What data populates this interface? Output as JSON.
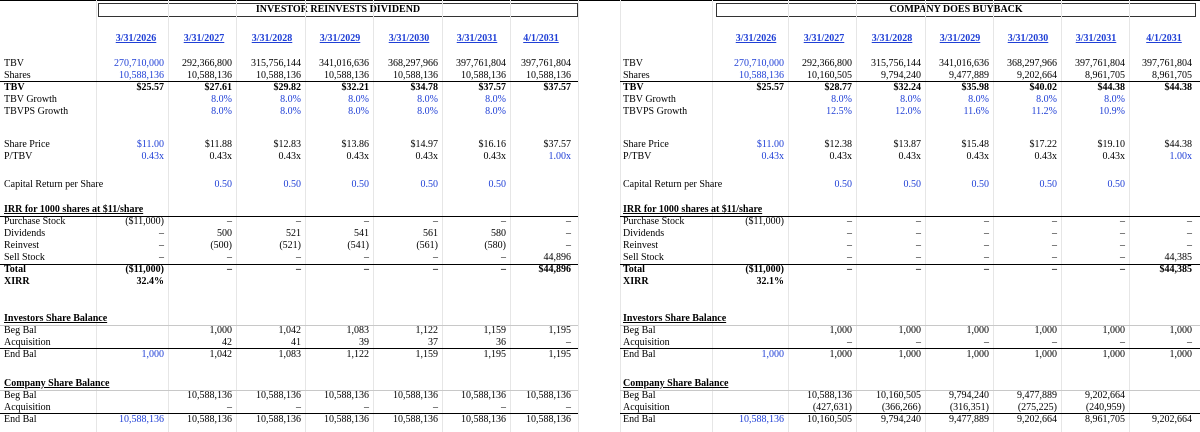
{
  "left_title": "INVESTOR REINVESTS DIVIDEND",
  "right_title": "COMPANY DOES BUYBACK",
  "left": {
    "dates": [
      "3/31/2026",
      "3/31/2027",
      "3/31/2028",
      "3/31/2029",
      "3/31/2030",
      "3/31/2031",
      "4/1/2031"
    ],
    "sections": [
      {
        "rows": [
          {
            "label": "TBV",
            "values": [
              "270,710,000",
              "292,366,800",
              "315,756,144",
              "341,016,636",
              "368,297,966",
              "397,761,804",
              "397,761,804"
            ]
          },
          {
            "label": "Shares",
            "values": [
              "10,588,136",
              "10,588,136",
              "10,588,136",
              "10,588,136",
              "10,588,136",
              "10,588,136",
              "10,588,136"
            ]
          },
          {
            "label": "TBV",
            "values": [
              "$25.57",
              "$27.61",
              "$29.82",
              "$32.21",
              "$34.78",
              "$37.57",
              "$37.57"
            ]
          },
          {
            "label": "TBV Growth",
            "values": [
              "",
              "8.0%",
              "8.0%",
              "8.0%",
              "8.0%",
              "8.0%",
              ""
            ]
          },
          {
            "label": "TBVPS Growth",
            "values": [
              "",
              "8.0%",
              "8.0%",
              "8.0%",
              "8.0%",
              "8.0%",
              ""
            ]
          }
        ]
      },
      {
        "rows": [
          {
            "label": "Share Price",
            "values": [
              "$11.00",
              "$11.88",
              "$12.83",
              "$13.86",
              "$14.97",
              "$16.16",
              "$37.57"
            ]
          },
          {
            "label": "P/TBV",
            "values": [
              "0.43x",
              "0.43x",
              "0.43x",
              "0.43x",
              "0.43x",
              "0.43x",
              "1.00x"
            ]
          }
        ]
      },
      {
        "rows": [
          {
            "label": "Capital Return per Share",
            "values": [
              "",
              "0.50",
              "0.50",
              "0.50",
              "0.50",
              "0.50",
              ""
            ]
          }
        ]
      },
      {
        "rows": [
          {
            "label": "IRR for 1000 shares at $11/share",
            "values": [
              "",
              "",
              "",
              "",
              "",
              "",
              ""
            ]
          },
          {
            "label": "Purchase Stock",
            "values": [
              "($11,000)",
              "–",
              "–",
              "–",
              "–",
              "–",
              "–"
            ]
          },
          {
            "label": "Dividends",
            "values": [
              "–",
              "500",
              "521",
              "541",
              "561",
              "580",
              "–"
            ]
          },
          {
            "label": "Reinvest",
            "values": [
              "–",
              "(500)",
              "(521)",
              "(541)",
              "(561)",
              "(580)",
              "–"
            ]
          },
          {
            "label": "Sell Stock",
            "values": [
              "–",
              "–",
              "–",
              "–",
              "–",
              "–",
              "44,896"
            ]
          },
          {
            "label": "Total",
            "values": [
              "($11,000)",
              "–",
              "–",
              "–",
              "–",
              "–",
              "$44,896"
            ]
          },
          {
            "label": "XIRR",
            "values": [
              "32.4%",
              "",
              "",
              "",
              "",
              "",
              ""
            ]
          }
        ]
      },
      {
        "rows": [
          {
            "label": "Investors Share Balance",
            "values": [
              "",
              "",
              "",
              "",
              "",
              "",
              ""
            ]
          },
          {
            "label": "Beg Bal",
            "values": [
              "",
              "1,000",
              "1,042",
              "1,083",
              "1,122",
              "1,159",
              "1,195"
            ]
          },
          {
            "label": "Acquisition",
            "values": [
              "",
              "42",
              "41",
              "39",
              "37",
              "36",
              "–"
            ]
          },
          {
            "label": "End Bal",
            "values": [
              "1,000",
              "1,042",
              "1,083",
              "1,122",
              "1,159",
              "1,195",
              "1,195"
            ]
          }
        ]
      },
      {
        "rows": [
          {
            "label": "Company Share Balance",
            "values": [
              "",
              "",
              "",
              "",
              "",
              "",
              ""
            ]
          },
          {
            "label": "Beg Bal",
            "values": [
              "",
              "10,588,136",
              "10,588,136",
              "10,588,136",
              "10,588,136",
              "10,588,136",
              "10,588,136"
            ]
          },
          {
            "label": "Acquisition",
            "values": [
              "",
              "–",
              "–",
              "–",
              "–",
              "–",
              "–"
            ]
          },
          {
            "label": "End Bal",
            "values": [
              "10,588,136",
              "10,588,136",
              "10,588,136",
              "10,588,136",
              "10,588,136",
              "10,588,136",
              "10,588,136"
            ]
          }
        ]
      }
    ]
  },
  "right": {
    "dates": [
      "3/31/2026",
      "3/31/2027",
      "3/31/2028",
      "3/31/2029",
      "3/31/2030",
      "3/31/2031",
      "4/1/2031"
    ],
    "sections": [
      {
        "rows": [
          {
            "label": "TBV",
            "values": [
              "270,710,000",
              "292,366,800",
              "315,756,144",
              "341,016,636",
              "368,297,966",
              "397,761,804",
              "397,761,804"
            ]
          },
          {
            "label": "Shares",
            "values": [
              "10,588,136",
              "10,160,505",
              "9,794,240",
              "9,477,889",
              "9,202,664",
              "8,961,705",
              "8,961,705"
            ]
          },
          {
            "label": "TBV",
            "values": [
              "$25.57",
              "$28.77",
              "$32.24",
              "$35.98",
              "$40.02",
              "$44.38",
              "$44.38"
            ]
          },
          {
            "label": "TBV Growth",
            "values": [
              "",
              "8.0%",
              "8.0%",
              "8.0%",
              "8.0%",
              "8.0%",
              ""
            ]
          },
          {
            "label": "TBVPS Growth",
            "values": [
              "",
              "12.5%",
              "12.0%",
              "11.6%",
              "11.2%",
              "10.9%",
              ""
            ]
          }
        ]
      },
      {
        "rows": [
          {
            "label": "Share Price",
            "values": [
              "$11.00",
              "$12.38",
              "$13.87",
              "$15.48",
              "$17.22",
              "$19.10",
              "$44.38"
            ]
          },
          {
            "label": "P/TBV",
            "values": [
              "0.43x",
              "0.43x",
              "0.43x",
              "0.43x",
              "0.43x",
              "0.43x",
              "1.00x"
            ]
          }
        ]
      },
      {
        "rows": [
          {
            "label": "Capital Return per Share",
            "values": [
              "",
              "0.50",
              "0.50",
              "0.50",
              "0.50",
              "0.50",
              ""
            ]
          }
        ]
      },
      {
        "rows": [
          {
            "label": "IRR for 1000 shares at $11/share",
            "values": [
              "",
              "",
              "",
              "",
              "",
              "",
              ""
            ]
          },
          {
            "label": "Purchase Stock",
            "values": [
              "($11,000)",
              "–",
              "–",
              "–",
              "–",
              "–",
              "–"
            ]
          },
          {
            "label": "Dividends",
            "values": [
              "",
              "–",
              "–",
              "–",
              "–",
              "–",
              "–"
            ]
          },
          {
            "label": "Reinvest",
            "values": [
              "",
              "–",
              "–",
              "–",
              "–",
              "–",
              "–"
            ]
          },
          {
            "label": "Sell Stock",
            "values": [
              "",
              "–",
              "–",
              "–",
              "–",
              "–",
              "44,385"
            ]
          },
          {
            "label": "Total",
            "values": [
              "($11,000)",
              "–",
              "–",
              "–",
              "–",
              "–",
              "$44,385"
            ]
          },
          {
            "label": "XIRR",
            "values": [
              "32.1%",
              "",
              "",
              "",
              "",
              "",
              ""
            ]
          }
        ]
      },
      {
        "rows": [
          {
            "label": "Investors Share Balance",
            "values": [
              "",
              "",
              "",
              "",
              "",
              "",
              ""
            ]
          },
          {
            "label": "Beg Bal",
            "values": [
              "",
              "1,000",
              "1,000",
              "1,000",
              "1,000",
              "1,000",
              "1,000"
            ]
          },
          {
            "label": "Acquisition",
            "values": [
              "",
              "–",
              "–",
              "–",
              "–",
              "–",
              "–"
            ]
          },
          {
            "label": "End Bal",
            "values": [
              "1,000",
              "1,000",
              "1,000",
              "1,000",
              "1,000",
              "1,000",
              "1,000"
            ]
          }
        ]
      },
      {
        "rows": [
          {
            "label": "Company Share Balance",
            "values": [
              "",
              "",
              "",
              "",
              "",
              "",
              ""
            ]
          },
          {
            "label": "Beg Bal",
            "values": [
              "",
              "10,588,136",
              "10,160,505",
              "9,794,240",
              "9,477,889",
              "9,202,664",
              ""
            ]
          },
          {
            "label": "Acquisition",
            "values": [
              "",
              "(427,631)",
              "(366,266)",
              "(316,351)",
              "(275,225)",
              "(240,959)",
              ""
            ]
          },
          {
            "label": "End Bal",
            "values": [
              "10,588,136",
              "10,160,505",
              "9,794,240",
              "9,477,889",
              "9,202,664",
              "8,961,705",
              "9,202,664"
            ]
          }
        ]
      }
    ]
  },
  "colors": {
    "input_blue": "#1f3fd6",
    "grid": "#e6e6e6",
    "rule": "#000000"
  }
}
